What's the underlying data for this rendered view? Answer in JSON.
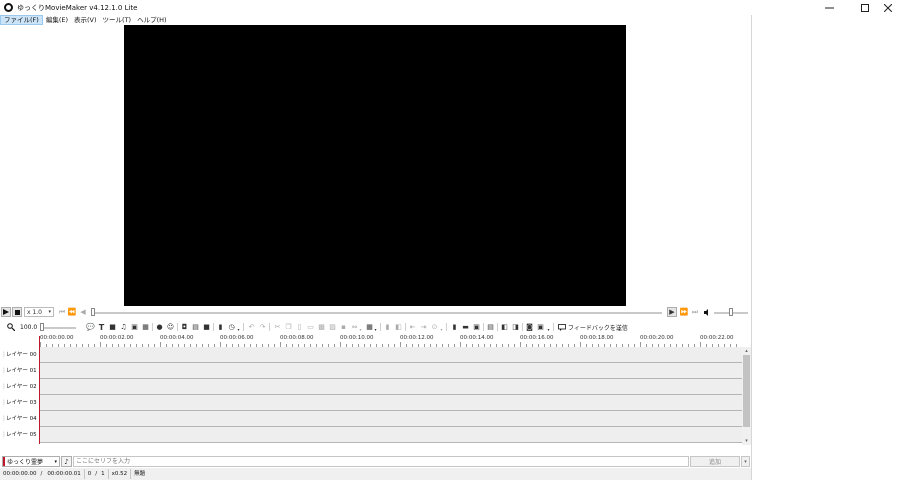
{
  "window": {
    "title": "ゆっくりMovieMaker v4.12.1.0 Lite",
    "minimize_icon": "minimize-icon",
    "maximize_icon": "maximize-icon",
    "close_icon": "close-icon"
  },
  "menu": {
    "items": [
      {
        "label": "ファイル(F)",
        "active": true
      },
      {
        "label": "編集(E)"
      },
      {
        "label": "表示(V)"
      },
      {
        "label": "ツール(T)"
      },
      {
        "label": "ヘルプ(H)"
      }
    ]
  },
  "playback": {
    "speed": "x 1.0"
  },
  "timeline_toolbar": {
    "zoom_value": "100.0",
    "feedback_label": "フィードバックを送信"
  },
  "ruler": {
    "ticks": [
      "00:00:00.00",
      "00:00:02.00",
      "00:00:04.00",
      "00:00:06.00",
      "00:00:08.00",
      "00:00:10.00",
      "00:00:12.00",
      "00:00:14.00",
      "00:00:16.00",
      "00:00:18.00",
      "00:00:20.00",
      "00:00:22.00"
    ]
  },
  "layers": [
    {
      "name": "レイヤー 00"
    },
    {
      "name": "レイヤー 01"
    },
    {
      "name": "レイヤー 02"
    },
    {
      "name": "レイヤー 03"
    },
    {
      "name": "レイヤー 04"
    },
    {
      "name": "レイヤー 05"
    }
  ],
  "input_row": {
    "character": "ゆっくり霊夢",
    "placeholder": "ここにセリフを入力",
    "add_label": "追加"
  },
  "status": {
    "current_time": "00:00:00.00",
    "separator": "/",
    "total_time": "00:00:00.01",
    "frame": "0",
    "frame_sep": "/",
    "frame_total": "1",
    "zoom": "x0.52",
    "project": "無題"
  },
  "colors": {
    "playhead": "#c0182b",
    "menu_active_bg": "#cce4f7",
    "track_bg": "#eeeeee"
  }
}
